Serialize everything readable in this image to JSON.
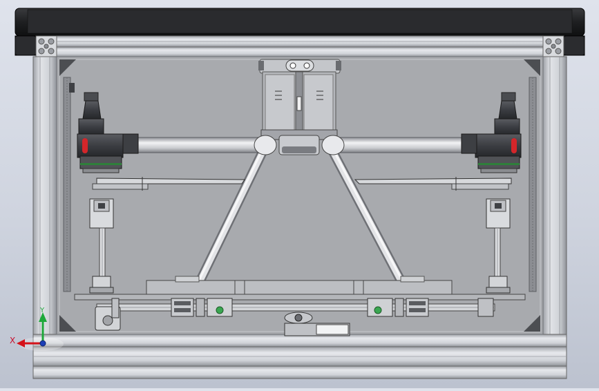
{
  "viewport": {
    "background_top": "#dfe3ec",
    "background_bottom": "#bcc2cf"
  },
  "colors": {
    "frame_top": "#1f1f21",
    "profile": "#c9ccd2",
    "inner_bg": "#a7a9ad",
    "tube": "#dcdde0",
    "motor_dark": "#3a3c40",
    "indicator_red": "#d3262a",
    "indicator_green": "#3aa651",
    "ring_green": "#2f7f3a",
    "axis_x": "#d4121a",
    "axis_y": "#1ea83a",
    "axis_z": "#1c3fb7"
  },
  "triad": {
    "x_label": "X",
    "y_label": "Y"
  }
}
